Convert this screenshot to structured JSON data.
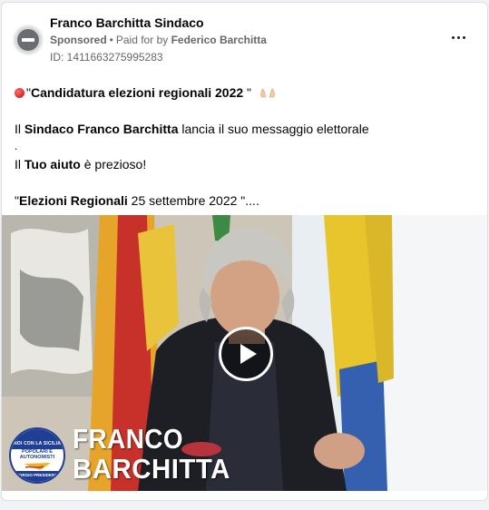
{
  "header": {
    "page_name": "Franco Barchitta Sindaco",
    "sponsored_label": "Sponsored",
    "separator": "•",
    "paid_for_prefix": "Paid for by",
    "payer_name": "Federico Barchitta",
    "ad_id_label": "ID: 1411663275995283",
    "more_icon": "more-horizontal-icon"
  },
  "post": {
    "line1_open_quote": "\"",
    "line1_bold": "Candidatura elezioni regionali 2022",
    "line1_close_quote": " \"",
    "line2_prefix": "Il ",
    "line2_bold": "Sindaco Franco Barchitta",
    "line2_suffix": " lancia il suo messaggio elettorale",
    "line3": ".",
    "line4_prefix": "Il ",
    "line4_bold": "Tuo aiuto",
    "line4_suffix": " è prezioso!",
    "line5_open_quote": "\"",
    "line5_bold": "Elezioni Regionali",
    "line5_suffix": " 25 settembre 2022 \"...."
  },
  "video": {
    "play_icon": "play-icon",
    "overlay_first_name": "FRANCO",
    "overlay_last_name": "BARCHITTA",
    "logo": {
      "top_text": "NOI CON LA SICILIA",
      "middle_line1": "POPOLARI E",
      "middle_line2": "AUTONOMISTI",
      "bottom_text": "GIORGIO PRESIDENTE"
    }
  },
  "colors": {
    "text_primary": "#050505",
    "text_secondary": "#65676b",
    "card_border": "#dddfe2",
    "logo_blue": "#1f3f95"
  }
}
